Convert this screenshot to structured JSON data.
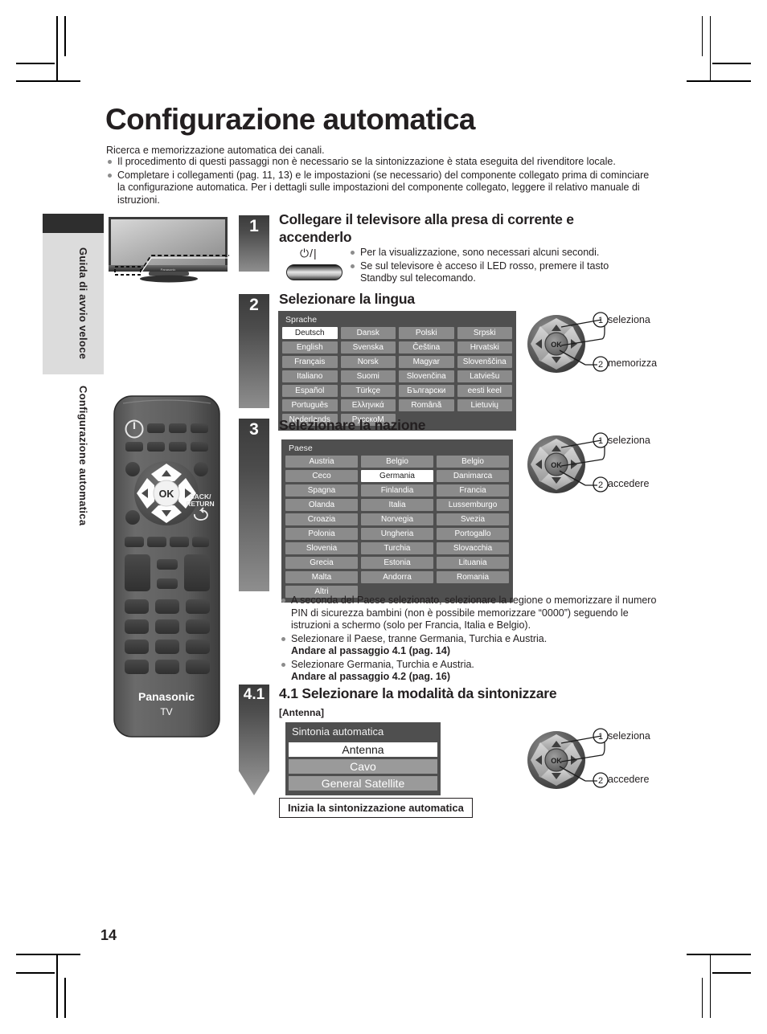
{
  "page": {
    "title": "Configurazione automatica",
    "intro": "Ricerca e memorizzazione automatica dei canali.",
    "intro_bullets": [
      "Il procedimento di questi passaggi non è necessario se la sintonizzazione è stata eseguita del rivenditore locale.",
      "Completare i collegamenti (pag. 11, 13) e le impostazioni (se necessario) del componente collegato prima di cominciare la configurazione automatica. Per i dettagli sulle impostazioni del componente collegato, leggere il relativo manuale di istruzioni."
    ],
    "page_number": "14"
  },
  "side_tabs": [
    {
      "label": "Guida di avvio veloce"
    },
    {
      "label": "Configurazione automatica"
    }
  ],
  "steps": {
    "step1": {
      "badge": "1",
      "heading": "Collegare il televisore alla presa di corrente e accenderlo",
      "power_symbol": "⏻/|",
      "bullets": [
        "Per la visualizzazione, sono necessari alcuni secondi.",
        "Se sul televisore è acceso il LED rosso, premere il tasto Standby sul telecomando."
      ]
    },
    "step2": {
      "badge": "2",
      "heading": "Selezionare la lingua",
      "osd_title": "Sprache",
      "columns": [
        [
          "Deutsch",
          "English",
          "Français",
          "Italiano",
          "Español",
          "Português",
          "Nederlands"
        ],
        [
          "Dansk",
          "Svenska",
          "Norsk",
          "Suomi",
          "Türkçe",
          "Ελληνικά",
          "РусскоM"
        ],
        [
          "Polski",
          "Čeština",
          "Magyar",
          "Slovenčina",
          "Български",
          "Română",
          ""
        ],
        [
          "Srpski",
          "Hrvatski",
          "Slovenščina",
          "Latviešu",
          "eesti keel",
          "Lietuvių",
          ""
        ]
      ],
      "selected": "Deutsch",
      "callout_1": "seleziona",
      "callout_2": "memorizza"
    },
    "step3": {
      "badge": "3",
      "heading": "Selezionare la nazione",
      "osd_title": "Paese",
      "columns": [
        [
          "Austria",
          "Ceco",
          "Spagna",
          "Olanda",
          "Croazia",
          "Polonia",
          "Slovenia",
          "Grecia",
          "Malta",
          "Altri"
        ],
        [
          "Belgio",
          "Germania",
          "Finlandia",
          "Italia",
          "Norvegia",
          "Ungheria",
          "Turchia",
          "Estonia",
          "Andorra",
          ""
        ],
        [
          "Belgio",
          "Danimarca",
          "Francia",
          "Lussemburgo",
          "Svezia",
          "Portogallo",
          "Slovacchia",
          "Lituania",
          "Romania",
          ""
        ]
      ],
      "selected": "Germania",
      "callout_1": "seleziona",
      "callout_2": "accedere",
      "bullets": [
        "A seconda del Paese selezionato, selezionare la regione o memorizzare il numero PIN di sicurezza bambini (non è possibile memorizzare “0000”) seguendo le istruzioni a schermo (solo per Francia, Italia e Belgio).",
        "Selezionare il Paese, tranne Germania, Turchia e Austria.",
        "Selezionare Germania, Turchia e Austria."
      ],
      "bold_lines": [
        "Andare al passaggio 4.1 (pag. 14)",
        "Andare al passaggio 4.2  (pag. 16)"
      ]
    },
    "step41": {
      "badge": "4.1",
      "heading": "4.1 Selezionare la modalità da sintonizzare",
      "subheading": "[Antenna]",
      "osd_title": "Sintonia automatica",
      "options": [
        "Antenna",
        "Cavo",
        "General Satellite"
      ],
      "selected": "Antenna",
      "start_label": "Inizia la sintonizzazione automatica",
      "callout_1": "seleziona",
      "callout_2": "accedere"
    }
  },
  "remote": {
    "brand": "Panasonic",
    "model_label": "TV",
    "ok_label": "OK",
    "back_label_1": "BACK/",
    "back_label_2": "RETURN"
  },
  "dpad": {
    "ok_label": "OK",
    "marker_1": "1",
    "marker_2": "2"
  },
  "colors": {
    "osd_background": "#4f4f4f",
    "osd_item": "#8b8b8b",
    "osd_selected": "#ffffff",
    "badge_dark": "#3b3b3b",
    "side_tab": "#dcdcdc",
    "text": "#231f20"
  }
}
